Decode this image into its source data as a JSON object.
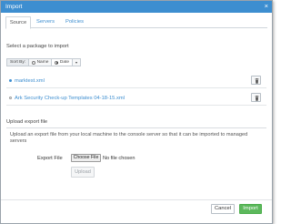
{
  "window": {
    "title": "Import",
    "close_glyph": "×"
  },
  "tabs": [
    {
      "label": "Source",
      "active": true
    },
    {
      "label": "Servers",
      "active": false
    },
    {
      "label": "Policies",
      "active": false
    }
  ],
  "source": {
    "select_label": "Select a package to import",
    "sort": {
      "label": "Sort By:",
      "options": [
        {
          "label": "Name",
          "selected": false
        },
        {
          "label": "Date",
          "selected": true
        }
      ]
    },
    "packages": [
      {
        "name": "marktest.xml",
        "selected": true
      },
      {
        "name": "Ark Security Check-up Templates 04-18-15.xml",
        "selected": false
      }
    ]
  },
  "upload": {
    "title": "Upload export file",
    "description": "Upload an export file from your local machine to the console server so that it can be imported to managed servers",
    "file_label": "Export File",
    "choose_label": "Choose File",
    "no_file_text": "No file chosen",
    "upload_label": "Upload"
  },
  "footer": {
    "cancel_label": "Cancel",
    "import_label": "Import"
  },
  "colors": {
    "titlebar": "#3d8ed0",
    "link": "#3d8ed0",
    "import_button": "#5cb85c"
  },
  "icons": {
    "close": "close-icon",
    "sort_dropdown": "chevron-down-icon",
    "delete": "trash-icon",
    "selected_marker": "dot-icon"
  }
}
